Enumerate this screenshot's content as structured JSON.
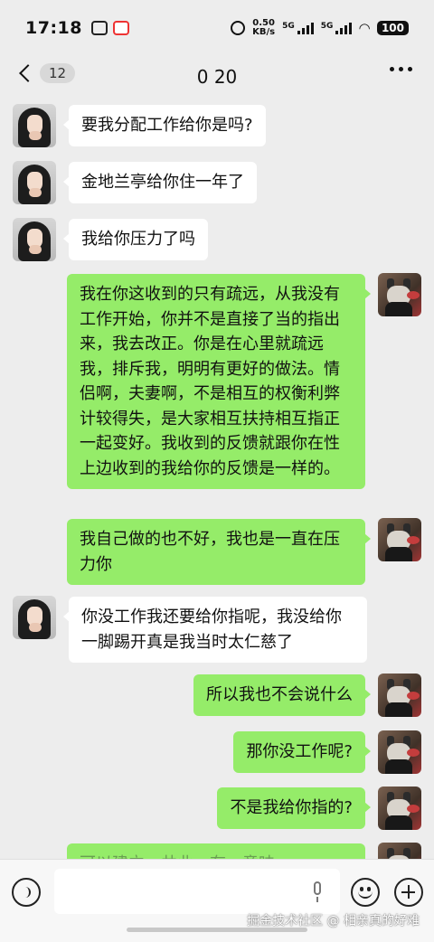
{
  "status_bar": {
    "time": "17:18",
    "net_speed_value": "0.50",
    "net_speed_unit": "KB/s",
    "sim1_label": "5G",
    "sim2_label": "5G",
    "battery": "100"
  },
  "header": {
    "unread_count": "12",
    "title": "0 20"
  },
  "messages": [
    {
      "side": "left",
      "text": "要我分配工作给你是吗?"
    },
    {
      "side": "left",
      "text": "金地兰亭给你住一年了"
    },
    {
      "side": "left",
      "text": "我给你压力了吗"
    },
    {
      "side": "right",
      "text": "我在你这收到的只有疏远，从我没有工作开始，你并不是直接了当的指出来，我去改正。你是在心里就疏远我，排斥我，明明有更好的做法。情侣啊，夫妻啊，不是相互的权衡利弊计较得失，是大家相互扶持相互指正一起变好。我收到的反馈就跟你在性上边收到的我给你的反馈是一样的。"
    },
    {
      "side": "right",
      "text": "我自己做的也不好，我也是一直在压力你"
    },
    {
      "side": "left",
      "text": "你没工作我还要给你指呢，我没给你一脚踢开真是我当时太仁慈了"
    },
    {
      "side": "right",
      "text": "所以我也不会说什么"
    },
    {
      "side": "right",
      "text": "那你没工作呢?"
    },
    {
      "side": "right",
      "text": "不是我给你指的?"
    },
    {
      "side": "right",
      "text": "可以建立、共业、有…意味…"
    }
  ],
  "input": {
    "value": "",
    "placeholder": ""
  },
  "watermark": "掘金技术社区 @ 相亲真的好难",
  "colors": {
    "background": "#ededed",
    "incoming_bubble": "#ffffff",
    "outgoing_bubble": "#95ec69"
  }
}
